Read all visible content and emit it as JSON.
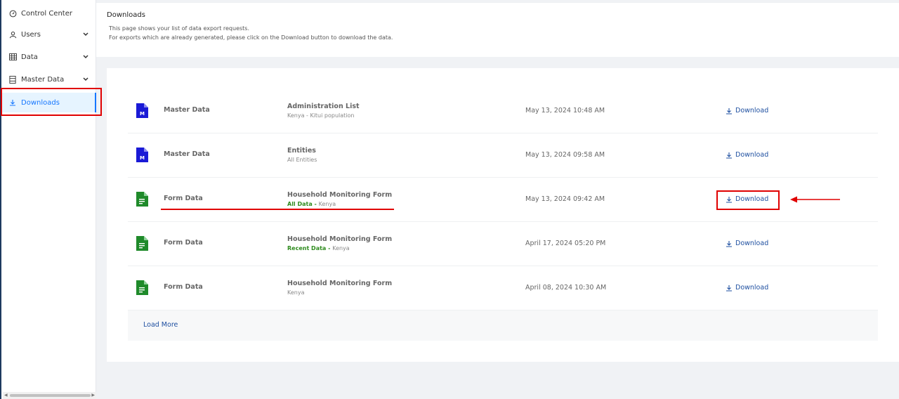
{
  "sidebar": {
    "items": [
      {
        "label": "Control Center",
        "icon": "dashboard-icon",
        "has_chevron": false
      },
      {
        "label": "Users",
        "icon": "user-icon",
        "has_chevron": true
      },
      {
        "label": "Data",
        "icon": "table-icon",
        "has_chevron": true
      },
      {
        "label": "Master Data",
        "icon": "database-icon",
        "has_chevron": true
      },
      {
        "label": "Downloads",
        "icon": "download-icon",
        "has_chevron": false,
        "active": true
      }
    ]
  },
  "header": {
    "title": "Downloads",
    "description_line1": "This page shows your list of data export requests.",
    "description_line2": "For exports which are already generated, please click on the Download button to download the data."
  },
  "downloads": [
    {
      "type": "Master Data",
      "name": "Administration List",
      "tag": "",
      "subtitle": "Kenya - Kitui population",
      "date": "May 13, 2024 10:48 AM",
      "action": "Download",
      "icon": "master-data-file-icon",
      "icon_color": "#1a1ad6"
    },
    {
      "type": "Master Data",
      "name": "Entities",
      "tag": "",
      "subtitle": "All Entities",
      "date": "May 13, 2024 09:58 AM",
      "action": "Download",
      "icon": "master-data-file-icon",
      "icon_color": "#1a1ad6"
    },
    {
      "type": "Form Data",
      "name": "Household Monitoring Form",
      "tag": "All Data - ",
      "subtitle": "Kenya",
      "date": "May 13, 2024 09:42 AM",
      "action": "Download",
      "icon": "form-data-file-icon",
      "icon_color": "#1f8a2a"
    },
    {
      "type": "Form Data",
      "name": "Household Monitoring Form",
      "tag": "Recent Data - ",
      "subtitle": "Kenya",
      "date": "April 17, 2024 05:20 PM",
      "action": "Download",
      "icon": "form-data-file-icon",
      "icon_color": "#1f8a2a"
    },
    {
      "type": "Form Data",
      "name": "Household Monitoring Form",
      "tag": "",
      "subtitle": "Kenya",
      "date": "April 08, 2024 10:30 AM",
      "action": "Download",
      "icon": "form-data-file-icon",
      "icon_color": "#1f8a2a"
    }
  ],
  "load_more_label": "Load More",
  "colors": {
    "accent": "#1677ff",
    "link": "#1e4fa0",
    "tag_green": "#2e8b1e",
    "annotation_red": "#e00000"
  }
}
